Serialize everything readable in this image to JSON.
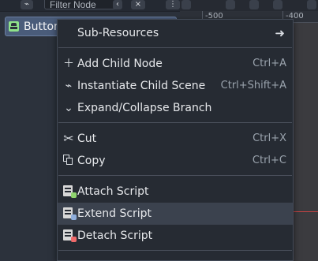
{
  "scene_dock": {
    "filter_placeholder": "Filter Node",
    "selected_node": "Button"
  },
  "viewport": {
    "ruler_labels": [
      "-500",
      "-400"
    ],
    "colors": {
      "guide": "#c74343"
    }
  },
  "context_menu": {
    "items": [
      {
        "label": "Sub-Resources",
        "icon": "chevron-right-icon"
      },
      {
        "label": "Add Child Node",
        "shortcut": "Ctrl+A",
        "icon": "plus-icon"
      },
      {
        "label": "Instantiate Child Scene",
        "shortcut": "Ctrl+Shift+A",
        "icon": "link-icon"
      },
      {
        "label": "Expand/Collapse Branch",
        "icon": "chevron-down-icon"
      },
      {
        "label": "Cut",
        "shortcut": "Ctrl+X",
        "icon": "scissors-icon"
      },
      {
        "label": "Copy",
        "shortcut": "Ctrl+C",
        "icon": "copy-icon"
      },
      {
        "label": "Attach Script",
        "icon": "script-attach-icon"
      },
      {
        "label": "Extend Script",
        "icon": "script-extend-icon"
      },
      {
        "label": "Detach Script",
        "icon": "script-detach-icon"
      }
    ],
    "highlighted_item": "Extend Script"
  }
}
